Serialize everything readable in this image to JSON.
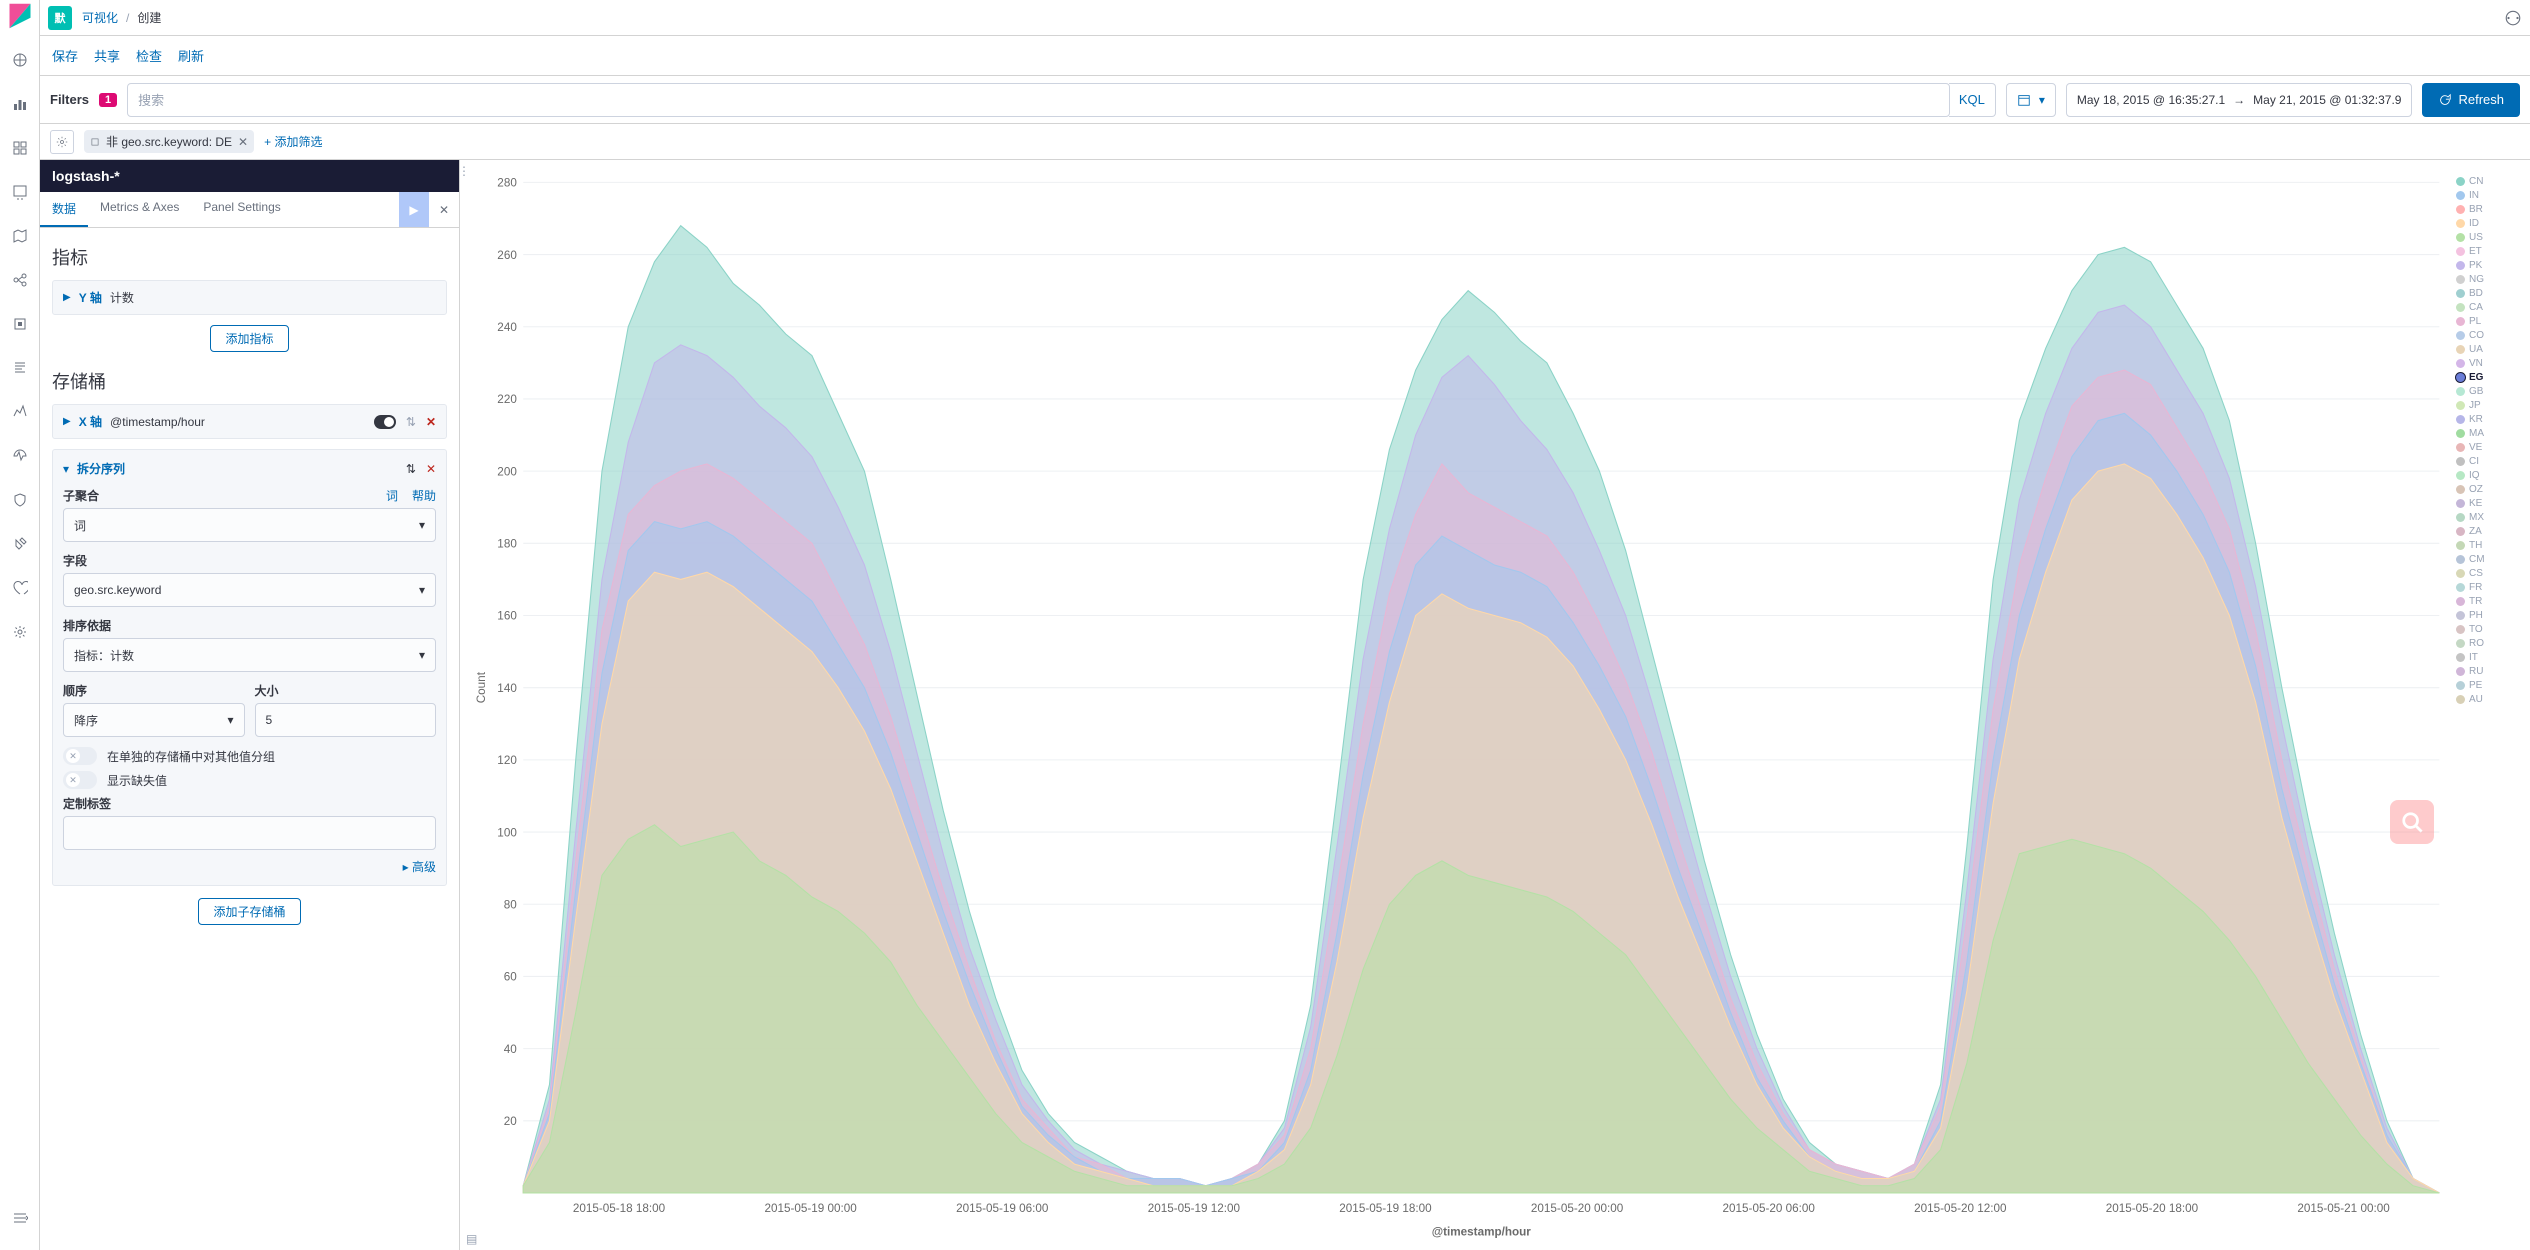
{
  "breadcrumb": {
    "mode_chip": "默",
    "l1": "可视化",
    "l2": "创建"
  },
  "menubar": {
    "save": "保存",
    "share": "共享",
    "inspect": "检查",
    "refresh": "刷新"
  },
  "filters": {
    "label": "Filters",
    "count": "1",
    "search_placeholder": "搜索",
    "kql_label": "KQL",
    "time_from": "May 18, 2015 @ 16:35:27.1",
    "time_to": "May 21, 2015 @ 01:32:37.9",
    "refresh_btn": "Refresh"
  },
  "filter_chips": {
    "pill_text": "非 geo.src.keyword: DE",
    "add_filter": "+ 添加筛选"
  },
  "index_pattern": "logstash-*",
  "tabs": {
    "data": "数据",
    "metrics": "Metrics & Axes",
    "panel": "Panel Settings"
  },
  "metrics": {
    "heading": "指标",
    "y_axis_name": "Y 轴",
    "y_axis_desc": "计数",
    "add_metric_btn": "添加指标"
  },
  "buckets": {
    "heading": "存储桶",
    "x_axis_name": "X 轴",
    "x_axis_desc": "@timestamp/hour",
    "split_name": "拆分序列",
    "sub_agg_label": "子聚合",
    "lnk_terms": "词",
    "lnk_help": "帮助",
    "sub_agg_value": "词",
    "field_label": "字段",
    "field_value": "geo.src.keyword",
    "order_by_label": "排序依据",
    "order_by_value": "指标：计数",
    "order_label": "顺序",
    "order_value": "降序",
    "size_label": "大小",
    "size_value": "5",
    "switch_group_label": "在单独的存储桶中对其他值分组",
    "switch_missing_label": "显示缺失值",
    "custom_label_label": "定制标签",
    "advanced": "高级",
    "add_sub_bucket": "添加子存储桶"
  },
  "chart_data": {
    "type": "area",
    "xlabel": "@timestamp/hour",
    "ylabel": "Count",
    "ylim": [
      0,
      280
    ],
    "yticks": [
      20,
      40,
      60,
      80,
      100,
      120,
      140,
      160,
      180,
      200,
      220,
      240,
      260,
      280
    ],
    "xticks": [
      "2015-05-18 18:00",
      "2015-05-19 00:00",
      "2015-05-19 06:00",
      "2015-05-19 12:00",
      "2015-05-19 18:00",
      "2015-05-20 00:00",
      "2015-05-20 06:00",
      "2015-05-20 12:00",
      "2015-05-20 18:00",
      "2015-05-21 00:00"
    ],
    "legend": [
      "CN",
      "IN",
      "BR",
      "ID",
      "US",
      "ET",
      "PK",
      "NG",
      "BD",
      "CA",
      "PL",
      "CO",
      "UA",
      "VN",
      "EG",
      "GB",
      "JP",
      "KR",
      "MA",
      "VE",
      "CI",
      "IQ",
      "OZ",
      "KE",
      "MX",
      "ZA",
      "TH",
      "CM",
      "CS",
      "FR",
      "TR",
      "PH",
      "TO",
      "RO",
      "IT",
      "RU",
      "PE",
      "AU"
    ],
    "legend_colors": [
      "#8bd3c7",
      "#a2c8ee",
      "#ffb1b1",
      "#ffd8a8",
      "#b4e1a6",
      "#f4c2e0",
      "#c3b7eb",
      "#d0d0d0",
      "#9fcfd0",
      "#c4e3c0",
      "#e8b6d4",
      "#b6cce8",
      "#e8d4b6",
      "#d4b6e8",
      "#6a7dd7",
      "#b6e8d4",
      "#d0e8b6",
      "#b6b6e8",
      "#a0dca0",
      "#e8b6b6",
      "#c0c0c0",
      "#b6e8c4",
      "#d8c4b6",
      "#c4b6d8",
      "#b6d8c4",
      "#d8b6c4",
      "#c4d8b6",
      "#b6c4d8",
      "#d8d8b6",
      "#b6d8d8",
      "#d8b6d8",
      "#c4c4d8",
      "#d8c4c4",
      "#c4d8c4",
      "#c4c4c4",
      "#d0b6d8",
      "#b6d0d8",
      "#d8d0b6"
    ],
    "selected_legend": "EG",
    "x_count": 57,
    "series_top": [
      {
        "name": "layer_total",
        "color": "#8bd3c7",
        "values": [
          2,
          30,
          120,
          200,
          240,
          258,
          268,
          262,
          252,
          246,
          238,
          232,
          216,
          200,
          170,
          138,
          106,
          78,
          54,
          34,
          22,
          14,
          10,
          6,
          4,
          4,
          2,
          4,
          8,
          20,
          52,
          110,
          170,
          206,
          228,
          242,
          250,
          244,
          236,
          230,
          216,
          200,
          178,
          150,
          122,
          92,
          66,
          44,
          26,
          14,
          8,
          6,
          4,
          8,
          30,
          96,
          170,
          214,
          234,
          250,
          260,
          262,
          258,
          246,
          234,
          214,
          180,
          140,
          104,
          72,
          44,
          20,
          4,
          0
        ]
      },
      {
        "name": "layer_purple",
        "color": "#c3b7eb",
        "values": [
          2,
          26,
          100,
          170,
          208,
          230,
          235,
          232,
          226,
          218,
          212,
          204,
          190,
          174,
          150,
          122,
          94,
          68,
          48,
          30,
          20,
          12,
          8,
          6,
          4,
          4,
          2,
          4,
          8,
          18,
          46,
          96,
          148,
          184,
          210,
          226,
          232,
          224,
          214,
          206,
          194,
          178,
          160,
          136,
          110,
          84,
          60,
          40,
          24,
          12,
          8,
          6,
          4,
          8,
          26,
          84,
          148,
          192,
          216,
          234,
          244,
          246,
          240,
          228,
          216,
          198,
          168,
          130,
          96,
          66,
          40,
          18,
          4,
          0
        ]
      },
      {
        "name": "layer_pink",
        "color": "#e8b6d4",
        "values": [
          2,
          24,
          92,
          156,
          188,
          196,
          200,
          202,
          198,
          192,
          186,
          180,
          166,
          152,
          132,
          108,
          84,
          62,
          42,
          26,
          18,
          10,
          8,
          4,
          4,
          4,
          2,
          4,
          8,
          16,
          40,
          84,
          130,
          166,
          188,
          202,
          194,
          190,
          186,
          182,
          172,
          158,
          142,
          122,
          98,
          76,
          54,
          36,
          22,
          12,
          8,
          6,
          4,
          8,
          24,
          76,
          134,
          174,
          198,
          218,
          226,
          228,
          224,
          212,
          200,
          184,
          156,
          120,
          90,
          62,
          38,
          16,
          4,
          0
        ]
      },
      {
        "name": "layer_lightblue",
        "color": "#a2c8ee",
        "values": [
          2,
          22,
          84,
          144,
          178,
          186,
          184,
          186,
          182,
          176,
          170,
          164,
          152,
          140,
          122,
          100,
          78,
          58,
          40,
          24,
          16,
          10,
          6,
          4,
          4,
          4,
          2,
          4,
          6,
          14,
          34,
          72,
          116,
          150,
          174,
          182,
          178,
          174,
          172,
          168,
          158,
          146,
          132,
          112,
          90,
          70,
          50,
          32,
          20,
          10,
          6,
          4,
          4,
          6,
          20,
          64,
          120,
          160,
          184,
          204,
          214,
          216,
          210,
          200,
          188,
          172,
          146,
          112,
          84,
          58,
          36,
          16,
          4,
          0
        ]
      },
      {
        "name": "layer_tan",
        "color": "#ffd8a8",
        "values": [
          2,
          20,
          76,
          130,
          164,
          172,
          170,
          172,
          168,
          162,
          156,
          150,
          140,
          128,
          112,
          92,
          72,
          52,
          36,
          22,
          14,
          8,
          6,
          4,
          2,
          2,
          2,
          2,
          6,
          12,
          30,
          64,
          104,
          136,
          160,
          166,
          162,
          160,
          158,
          154,
          146,
          134,
          120,
          102,
          82,
          64,
          46,
          30,
          18,
          10,
          6,
          4,
          4,
          6,
          18,
          56,
          108,
          148,
          172,
          192,
          200,
          202,
          198,
          188,
          176,
          160,
          136,
          104,
          78,
          54,
          34,
          14,
          4,
          0
        ]
      },
      {
        "name": "layer_green",
        "color": "#b4e1a6",
        "values": [
          2,
          14,
          50,
          88,
          98,
          102,
          96,
          98,
          100,
          92,
          88,
          82,
          78,
          72,
          64,
          52,
          42,
          32,
          22,
          14,
          10,
          6,
          4,
          2,
          2,
          2,
          2,
          2,
          4,
          8,
          18,
          38,
          62,
          80,
          88,
          92,
          88,
          86,
          84,
          82,
          78,
          72,
          66,
          56,
          46,
          36,
          26,
          18,
          12,
          6,
          4,
          2,
          2,
          4,
          12,
          36,
          70,
          94,
          96,
          98,
          96,
          94,
          90,
          84,
          78,
          70,
          60,
          48,
          36,
          26,
          16,
          8,
          2,
          0
        ]
      }
    ]
  }
}
